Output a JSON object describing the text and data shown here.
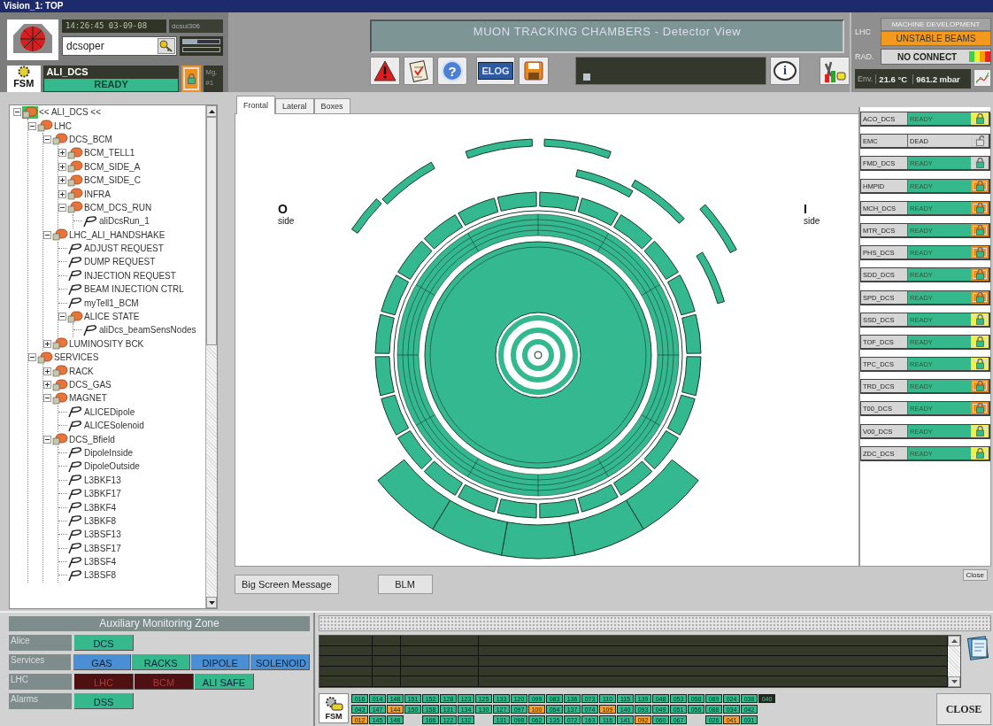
{
  "window": {
    "title": "Vision_1: TOP"
  },
  "header": {
    "time": "14:26:45 03-09-08",
    "host": "dcsui306",
    "user": "dcsoper",
    "fsm": "FSM",
    "node": {
      "name": "ALI_DCS",
      "state": "READY"
    },
    "mg": "Mg. #1",
    "banner": "MUON TRACKING CHAMBERS - Detector View",
    "toolbar": [
      {
        "kind": "alert"
      },
      {
        "kind": "checklist"
      },
      {
        "kind": "help",
        "label": "?"
      },
      {
        "kind": "elog",
        "label": "ELOG"
      },
      {
        "kind": "save"
      },
      {
        "kind": "message"
      },
      {
        "kind": "info",
        "label": "i"
      },
      {
        "kind": "tools"
      }
    ],
    "lhc": {
      "label": "LHC",
      "mode": "MACHINE DEVELOPMENT",
      "beam": "UNSTABLE BEAMS"
    },
    "rad": {
      "label": "RAD.",
      "value": "NO CONNECT"
    },
    "env": {
      "label": "Env.",
      "temperature": "21.6 °C",
      "pressure": "961.2 mbar"
    }
  },
  "tree": {
    "items": [
      {
        "kind": "node",
        "label": "<< ALI_DCS <<",
        "expanded": true,
        "selected": true,
        "children": [
          {
            "kind": "node",
            "label": "LHC",
            "expanded": true,
            "selected": false,
            "children": [
              {
                "kind": "node",
                "label": "DCS_BCM",
                "expanded": true,
                "selected": false,
                "children": [
                  {
                    "kind": "node",
                    "label": "BCM_TELL1",
                    "expanded": false,
                    "selected": false
                  },
                  {
                    "kind": "node",
                    "label": "BCM_SIDE_A",
                    "expanded": false,
                    "selected": false
                  },
                  {
                    "kind": "node",
                    "label": "BCM_SIDE_C",
                    "expanded": false,
                    "selected": false
                  },
                  {
                    "kind": "node",
                    "label": "INFRA",
                    "expanded": false,
                    "selected": false
                  },
                  {
                    "kind": "node",
                    "label": "BCM_DCS_RUN",
                    "expanded": true,
                    "selected": false,
                    "children": [
                      {
                        "kind": "leaf",
                        "label": "aliDcsRun_1",
                        "selected": false
                      }
                    ]
                  }
                ]
              },
              {
                "kind": "node",
                "label": "LHC_ALI_HANDSHAKE",
                "expanded": true,
                "selected": false,
                "children": [
                  {
                    "kind": "leaf",
                    "label": "ADJUST REQUEST",
                    "selected": false
                  },
                  {
                    "kind": "leaf",
                    "label": "DUMP REQUEST",
                    "selected": false
                  },
                  {
                    "kind": "leaf",
                    "label": "INJECTION REQUEST",
                    "selected": false
                  },
                  {
                    "kind": "leaf",
                    "label": "BEAM INJECTION CTRL",
                    "selected": false
                  },
                  {
                    "kind": "leaf",
                    "label": "myTell1_BCM",
                    "selected": false
                  },
                  {
                    "kind": "node",
                    "label": "ALICE STATE",
                    "expanded": true,
                    "selected": false,
                    "children": [
                      {
                        "kind": "leaf",
                        "label": "aliDcs_beamSensNodes",
                        "selected": false
                      }
                    ]
                  }
                ]
              },
              {
                "kind": "node",
                "label": "LUMINOSITY BCK",
                "expanded": false,
                "selected": false
              }
            ]
          },
          {
            "kind": "node",
            "label": "SERVICES",
            "expanded": true,
            "selected": false,
            "children": [
              {
                "kind": "node",
                "label": "RACK",
                "expanded": false,
                "selected": false
              },
              {
                "kind": "node",
                "label": "DCS_GAS",
                "expanded": false,
                "selected": false
              },
              {
                "kind": "node",
                "label": "MAGNET",
                "expanded": true,
                "selected": false,
                "children": [
                  {
                    "kind": "leaf",
                    "label": "ALICEDipole",
                    "selected": false
                  },
                  {
                    "kind": "leaf",
                    "label": "ALICESolenoid",
                    "selected": false
                  }
                ]
              },
              {
                "kind": "node",
                "label": "DCS_Bfield",
                "expanded": true,
                "selected": false,
                "children": [
                  {
                    "kind": "leaf",
                    "label": "DipoleInside",
                    "selected": false
                  },
                  {
                    "kind": "leaf",
                    "label": "DipoleOutside",
                    "selected": false
                  },
                  {
                    "kind": "leaf",
                    "label": "L3BKF13",
                    "selected": false
                  },
                  {
                    "kind": "leaf",
                    "label": "L3BKF17",
                    "selected": false
                  },
                  {
                    "kind": "leaf",
                    "label": "L3BKF4",
                    "selected": false
                  },
                  {
                    "kind": "leaf",
                    "label": "L3BKF8",
                    "selected": false
                  },
                  {
                    "kind": "leaf",
                    "label": "L3BSF13",
                    "selected": false
                  },
                  {
                    "kind": "leaf",
                    "label": "L3BSF17",
                    "selected": false
                  },
                  {
                    "kind": "leaf",
                    "label": "L3BSF4",
                    "selected": false
                  },
                  {
                    "kind": "leaf",
                    "label": "L3BSF8",
                    "selected": false
                  }
                ]
              }
            ]
          }
        ]
      }
    ]
  },
  "tabs": [
    {
      "label": "Frontal",
      "selected": true
    },
    {
      "label": "Lateral",
      "selected": false
    },
    {
      "label": "Boxes",
      "selected": false
    }
  ],
  "sides": [
    {
      "letter": "O",
      "label": "side"
    },
    {
      "letter": "I",
      "label": "side"
    }
  ],
  "subsystems": [
    {
      "name": "ACO_DCS",
      "state": "READY",
      "kind": "ready",
      "color": "#f2ee4a"
    },
    {
      "name": "EMC",
      "state": "DEAD",
      "kind": "dead",
      "color": "#cfcfcf"
    },
    {
      "name": "FMD_DCS",
      "state": "READY",
      "kind": "ready",
      "color": "#cfcfcf"
    },
    {
      "name": "HMPID",
      "state": "READY",
      "kind": "ready",
      "color": "#f0901e"
    },
    {
      "name": "MCH_DCS",
      "state": "READY",
      "kind": "ready",
      "color": "#f0901e"
    },
    {
      "name": "MTR_DCS",
      "state": "READY",
      "kind": "ready",
      "color": "#f0901e"
    },
    {
      "name": "PHS_DCS",
      "state": "READY",
      "kind": "ready",
      "color": "#f0901e"
    },
    {
      "name": "SDD_DCS",
      "state": "READY",
      "kind": "ready",
      "color": "#f0901e"
    },
    {
      "name": "SPD_DCS",
      "state": "READY",
      "kind": "ready",
      "color": "#f0901e"
    },
    {
      "name": "SSD_DCS",
      "state": "READY",
      "kind": "ready",
      "color": "#f2ee4a"
    },
    {
      "name": "TOF_DCS",
      "state": "READY",
      "kind": "ready",
      "color": "#f2ee4a"
    },
    {
      "name": "TPC_DCS",
      "state": "READY",
      "kind": "ready",
      "color": "#f2ee4a"
    },
    {
      "name": "TRD_DCS",
      "state": "READY",
      "kind": "ready",
      "color": "#f0901e"
    },
    {
      "name": "T00_DCS",
      "state": "READY",
      "kind": "ready",
      "color": "#f0901e"
    },
    {
      "name": "V00_DCS",
      "state": "READY",
      "kind": "ready",
      "color": "#f2ee4a"
    },
    {
      "name": "ZDC_DCS",
      "state": "READY",
      "kind": "ready",
      "color": "#f2ee4a"
    }
  ],
  "buttons": {
    "message": "Big Screen Message",
    "blm": "BLM",
    "close_small": "Close"
  },
  "aux": {
    "title": "Auxiliary Monitoring Zone",
    "rows": [
      {
        "label": "Alice",
        "items": [
          {
            "label": "DCS",
            "color": "#35b88c"
          }
        ]
      },
      {
        "label": "Services",
        "items": [
          {
            "label": "GAS",
            "color": "#4a8fd4"
          },
          {
            "label": "RACKS",
            "color": "#35b88c"
          },
          {
            "label": "DIPOLE",
            "color": "#4a8fd4"
          },
          {
            "label": "SOLENOID",
            "color": "#4a8fd4"
          }
        ]
      },
      {
        "label": "LHC",
        "items": [
          {
            "label": "LHC",
            "color": "#4e1010"
          },
          {
            "label": "BCM",
            "color": "#4e1010"
          },
          {
            "label": "ALI SAFE",
            "color": "#35b88c"
          }
        ]
      },
      {
        "label": "Alarms",
        "items": [
          {
            "label": "DSS",
            "color": "#35b88c"
          }
        ]
      }
    ]
  },
  "fsm_grid": {
    "label": "FSM",
    "rows": [
      [
        {
          "label": "016",
          "color": "#35b88c"
        },
        {
          "label": "014",
          "color": "#35b88c"
        },
        {
          "label": "148",
          "color": "#35b88c"
        },
        {
          "label": "151",
          "color": "#35b88c"
        },
        {
          "label": "152",
          "color": "#35b88c"
        },
        {
          "label": "128",
          "color": "#35b88c"
        },
        {
          "label": "123",
          "color": "#35b88c"
        },
        {
          "label": "125",
          "color": "#35b88c"
        },
        {
          "label": "133",
          "color": "#35b88c"
        },
        {
          "label": "120",
          "color": "#35b88c"
        },
        {
          "label": "099",
          "color": "#35b88c"
        },
        {
          "label": "083",
          "color": "#35b88c"
        },
        {
          "label": "136",
          "color": "#35b88c"
        },
        {
          "label": "073",
          "color": "#35b88c"
        },
        {
          "label": "110",
          "color": "#35b88c"
        },
        {
          "label": "115",
          "color": "#35b88c"
        },
        {
          "label": "139",
          "color": "#35b88c"
        },
        {
          "label": "048",
          "color": "#35b88c"
        },
        {
          "label": "053",
          "color": "#35b88c"
        },
        {
          "label": "058",
          "color": "#35b88c"
        },
        {
          "label": "089",
          "color": "#35b88c"
        },
        {
          "label": "024",
          "color": "#35b88c"
        },
        {
          "label": "038",
          "color": "#35b88c"
        },
        {
          "label": "040",
          "color": "#1c2a20"
        }
      ],
      [
        {
          "label": "043",
          "color": "#35b88c"
        },
        {
          "label": "147",
          "color": "#35b88c"
        },
        {
          "label": "144",
          "color": "#f0a030"
        },
        {
          "label": "150",
          "color": "#35b88c"
        },
        {
          "label": "158",
          "color": "#35b88c"
        },
        {
          "label": "131",
          "color": "#35b88c"
        },
        {
          "label": "134",
          "color": "#35b88c"
        },
        {
          "label": "130",
          "color": "#35b88c"
        },
        {
          "label": "127",
          "color": "#35b88c"
        },
        {
          "label": "097",
          "color": "#35b88c"
        },
        {
          "label": "100",
          "color": "#f0a030"
        },
        {
          "label": "054",
          "color": "#35b88c"
        },
        {
          "label": "137",
          "color": "#35b88c"
        },
        {
          "label": "074",
          "color": "#35b88c"
        },
        {
          "label": "109",
          "color": "#f0a030"
        },
        {
          "label": "140",
          "color": "#35b88c"
        },
        {
          "label": "093",
          "color": "#35b88c"
        },
        {
          "label": "049",
          "color": "#35b88c"
        },
        {
          "label": "051",
          "color": "#35b88c"
        },
        {
          "label": "056",
          "color": "#35b88c"
        },
        {
          "label": "088",
          "color": "#35b88c"
        },
        {
          "label": "034",
          "color": "#35b88c"
        },
        {
          "label": "042",
          "color": "#35b88c"
        }
      ],
      [
        {
          "label": "012",
          "color": "#f0a030"
        },
        {
          "label": "145",
          "color": "#35b88c"
        },
        {
          "label": "148",
          "color": "#35b88c"
        },
        "",
        {
          "label": "166",
          "color": "#35b88c"
        },
        {
          "label": "122",
          "color": "#35b88c"
        },
        {
          "label": "132",
          "color": "#35b88c"
        },
        "",
        {
          "label": "131",
          "color": "#35b88c"
        },
        {
          "label": "098",
          "color": "#35b88c"
        },
        {
          "label": "062",
          "color": "#35b88c"
        },
        {
          "label": "135",
          "color": "#35b88c"
        },
        {
          "label": "072",
          "color": "#35b88c"
        },
        {
          "label": "163",
          "color": "#35b88c"
        },
        {
          "label": "116",
          "color": "#35b88c"
        },
        {
          "label": "141",
          "color": "#35b88c"
        },
        {
          "label": "092",
          "color": "#f0a030"
        },
        {
          "label": "060",
          "color": "#35b88c"
        },
        {
          "label": "067",
          "color": "#35b88c"
        },
        "",
        {
          "label": "026",
          "color": "#35b88c"
        },
        {
          "label": "041",
          "color": "#f0a030"
        },
        {
          "label": "031",
          "color": "#35b88c"
        }
      ]
    ]
  },
  "close": "CLOSE"
}
